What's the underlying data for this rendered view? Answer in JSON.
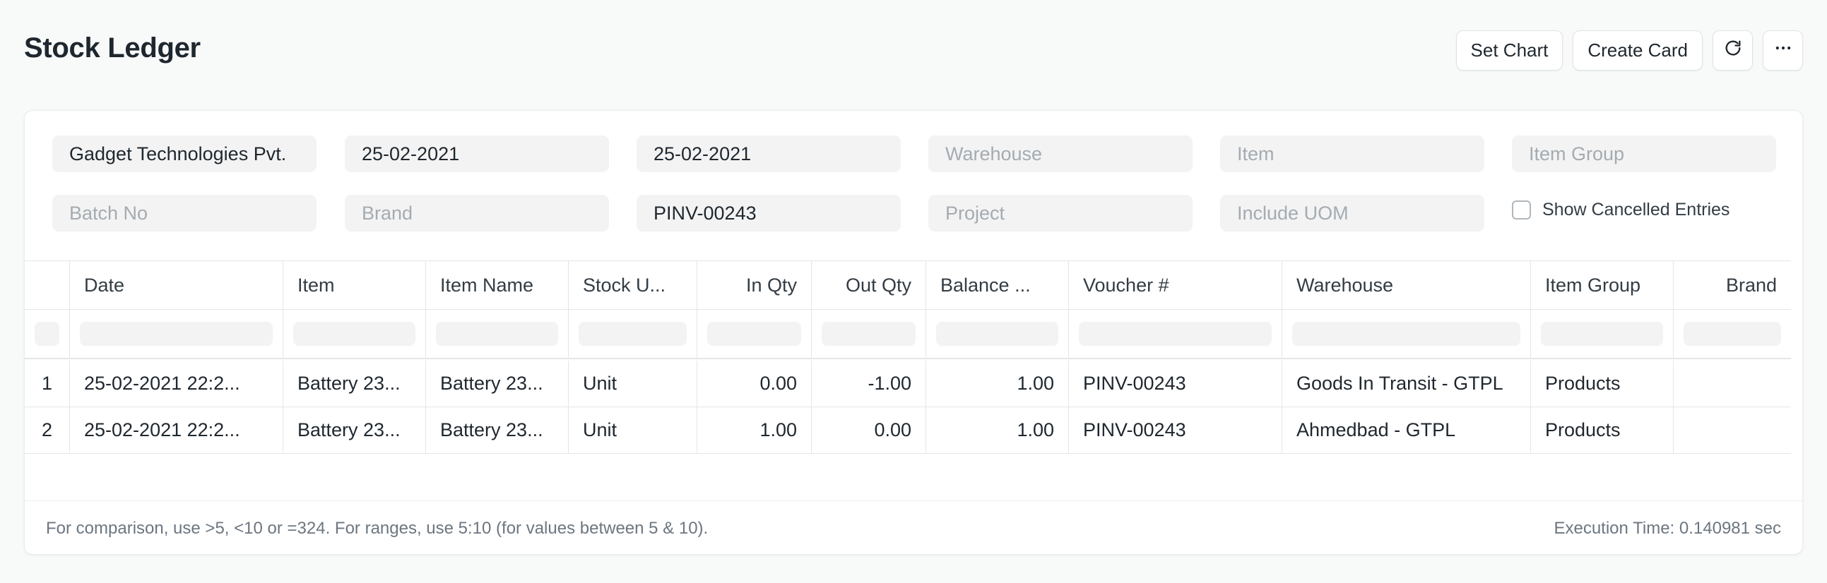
{
  "page": {
    "title": "Stock Ledger"
  },
  "toolbar": {
    "set_chart_label": "Set Chart",
    "create_card_label": "Create Card"
  },
  "filters": {
    "company": "Gadget Technologies Pvt.",
    "from_date": "25-02-2021",
    "to_date": "25-02-2021",
    "warehouse_placeholder": "Warehouse",
    "item_placeholder": "Item",
    "item_group_placeholder": "Item Group",
    "batch_no_placeholder": "Batch No",
    "brand_placeholder": "Brand",
    "voucher_no": "PINV-00243",
    "project_placeholder": "Project",
    "include_uom_placeholder": "Include UOM",
    "show_cancelled_label": "Show Cancelled Entries"
  },
  "table": {
    "columns": [
      "Date",
      "Item",
      "Item Name",
      "Stock U...",
      "In Qty",
      "Out Qty",
      "Balance ...",
      "Voucher #",
      "Warehouse",
      "Item Group",
      "Brand"
    ],
    "rows": [
      {
        "index": "1",
        "date": "25-02-2021 22:2...",
        "item": "Battery 23...",
        "item_name": "Battery 23...",
        "stock_uom": "Unit",
        "in_qty": "0.00",
        "out_qty": "-1.00",
        "balance": "1.00",
        "voucher": "PINV-00243",
        "warehouse": "Goods In Transit - GTPL",
        "item_group": "Products",
        "brand": ""
      },
      {
        "index": "2",
        "date": "25-02-2021 22:2...",
        "item": "Battery 23...",
        "item_name": "Battery 23...",
        "stock_uom": "Unit",
        "in_qty": "1.00",
        "out_qty": "0.00",
        "balance": "1.00",
        "voucher": "PINV-00243",
        "warehouse": "Ahmedbad - GTPL",
        "item_group": "Products",
        "brand": ""
      }
    ]
  },
  "footer": {
    "hint": "For comparison, use >5, <10 or =324. For ranges, use 5:10 (for values between 5 & 10).",
    "execution_time": "Execution Time: 0.140981 sec"
  },
  "icons": {
    "refresh": "refresh-icon",
    "more": "more-icon"
  },
  "colors": {
    "negative": "#e03636",
    "positive": "#3a8a1e"
  }
}
